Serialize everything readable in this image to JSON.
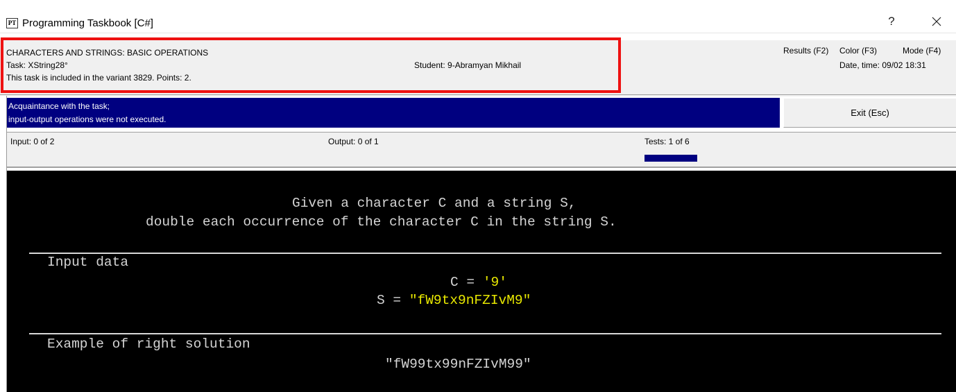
{
  "window": {
    "title": "Programming Taskbook [C#]",
    "icon_label": "PT",
    "help_label": "?"
  },
  "info": {
    "topic": "CHARACTERS AND STRINGS: BASIC OPERATIONS",
    "task": "Task: XString28°",
    "variant": "This task is included in the variant 3829. Points: 2.",
    "student": "Student: 9-Abramyan Mikhail",
    "results_label": "Results (F2)",
    "color_label": "Color (F3)",
    "mode_label": "Mode (F4)",
    "datetime": "Date, time: 09/02 18:31"
  },
  "status": {
    "line1": "Acquaintance with the task;",
    "line2": " input-output operations were not executed.",
    "exit_label": "Exit (Esc)"
  },
  "counters": {
    "input": "Input: 0 of 2",
    "output": "Output: 0 of 1",
    "tests": "Tests: 1 of 6",
    "tests_progress": 0.17
  },
  "console": {
    "desc_line1": "Given a character C and a string S,",
    "desc_line2": "double each occurrence of the character C in the string S.",
    "input_header": "Input data",
    "c_label": "C = ",
    "c_value": "'9'",
    "s_label": "S = ",
    "s_value": "\"fW9tx9nFZIvM9\"",
    "example_header": "Example of right solution",
    "example_value": "\"fW99tx99nFZIvM99\""
  },
  "colors": {
    "status_bg": "#000080",
    "highlight": "#ee1111",
    "console_text": "#d4d4d4",
    "console_value": "#e8e800"
  }
}
